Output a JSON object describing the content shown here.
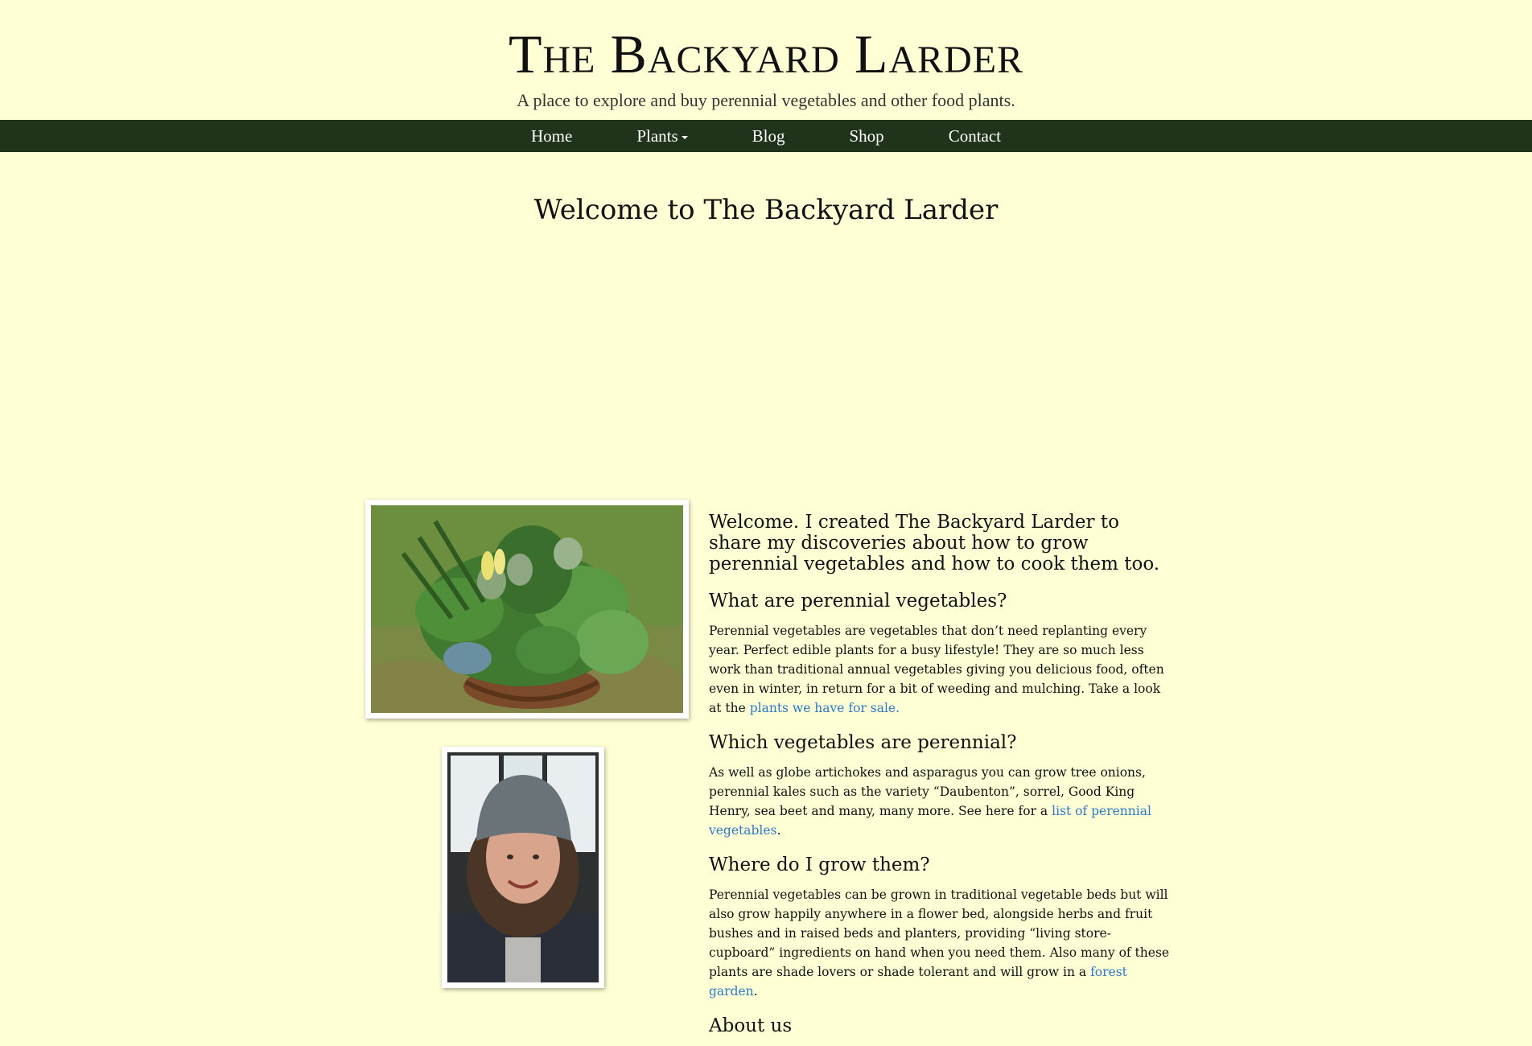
{
  "header": {
    "title": "The Backyard Larder",
    "tagline": "A place to explore and buy perennial vegetables and other food plants."
  },
  "nav": {
    "items": [
      "Home",
      "Plants",
      "Blog",
      "Shop",
      "Contact"
    ]
  },
  "page_title": "Welcome to The Backyard Larder",
  "intro": "Welcome. I created The Backyard Larder to share my discoveries about how to grow perennial vegetables and how to cook them too.",
  "sections": [
    {
      "heading": "What are perennial vegetables?",
      "text": "Perennial vegetables are vegetables that don’t need replanting every year. Perfect edible plants for a busy lifestyle! They are so much less work than traditional annual vegetables giving you delicious food, often even in winter, in return for a bit of weeding and mulching. Take a look at the ",
      "link": "plants we have for sale.",
      "after": ""
    },
    {
      "heading": "Which vegetables are perennial?",
      "text": "As well as globe artichokes and asparagus you can grow tree onions, perennial kales such as the variety “Daubenton”, sorrel, Good King Henry, sea beet and many, many more. See here for a ",
      "link": "list of perennial vegetables",
      "after": "."
    },
    {
      "heading": "Where do I grow them?",
      "text": "Perennial vegetables can be grown in traditional vegetable beds but will also grow happily anywhere in a flower bed, alongside herbs and fruit bushes and in raised beds and planters, providing “living store-cupboard” ingredients on hand when you need them. Also many of these plants are shade lovers or shade tolerant and will grow in a ",
      "link": "forest garden",
      "after": "."
    }
  ],
  "about_heading": "About us",
  "colors": {
    "background": "#ffffd5",
    "nav": "#1f341a",
    "link": "#2a7ac8"
  }
}
